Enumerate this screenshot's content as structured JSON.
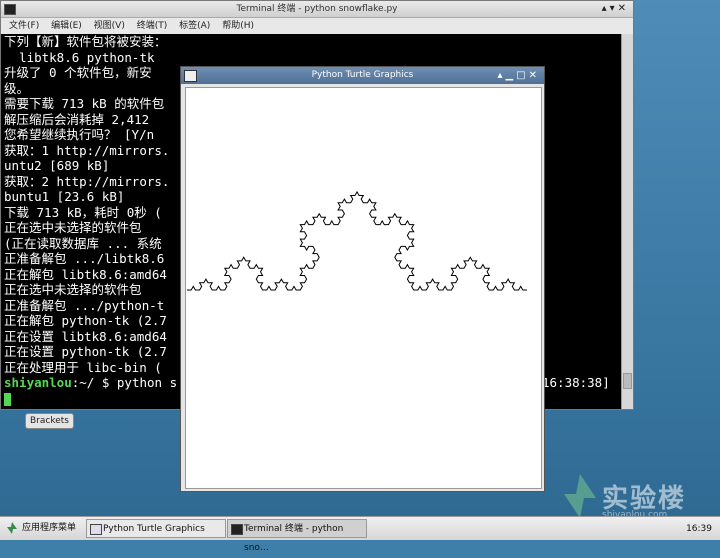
{
  "terminal": {
    "title": "Terminal 终端 - python snowflake.py",
    "menu": [
      "文件(F)",
      "编辑(E)",
      "视图(V)",
      "终端(T)",
      "标签(A)",
      "帮助(H)"
    ],
    "window_controls": "▴▾✕",
    "lines": [
      "下列【新】软件包将被安装：",
      "  libtk8.6 python-tk",
      "升级了 0 个软件包，新安                                      升包未被升",
      "级。",
      "需要下载 713 kB 的软件包",
      "解压缩后会消耗掉 2,412",
      "您希望继续执行吗？ [Y/n",
      "获取：1 http://mirrors.                               8.6.1-3ub",
      "untu2 [689 kB]",
      "获取：2 http://mirrors.                               4 2.7.5-1u",
      "buntu1 [23.6 kB]",
      "下载 713 kB，耗时 0秒 (",
      "正在选中未选择的软件包",
      "(正在读取数据库 ... 系统",
      "正准备解包 .../libtk8.6",
      "正在解包 libtk8.6:amd64",
      "正在选中未选择的软件包",
      "正准备解包 .../python-t",
      "正在解包 python-tk (2.7",
      "正在设置 libtk8.6:amd64",
      "正在设置 python-tk (2.7",
      "正在处理用于 libc-bin ("
    ],
    "prompt_user": "shiyanlou",
    "prompt_rest": ":~/ $ python s",
    "prompt_right": "16:38:38]"
  },
  "brackets_label": "Brackets",
  "turtle": {
    "title": "Python Turtle Graphics",
    "window_controls": "▴▁□✕"
  },
  "watermark": {
    "text": "实验楼",
    "sub": "shiyanlou.com"
  },
  "taskbar": {
    "start_label": "应用程序菜单",
    "tasks": [
      "Python Turtle Graphics",
      "Terminal 终端 - python sno…"
    ],
    "clock": "16:39"
  }
}
